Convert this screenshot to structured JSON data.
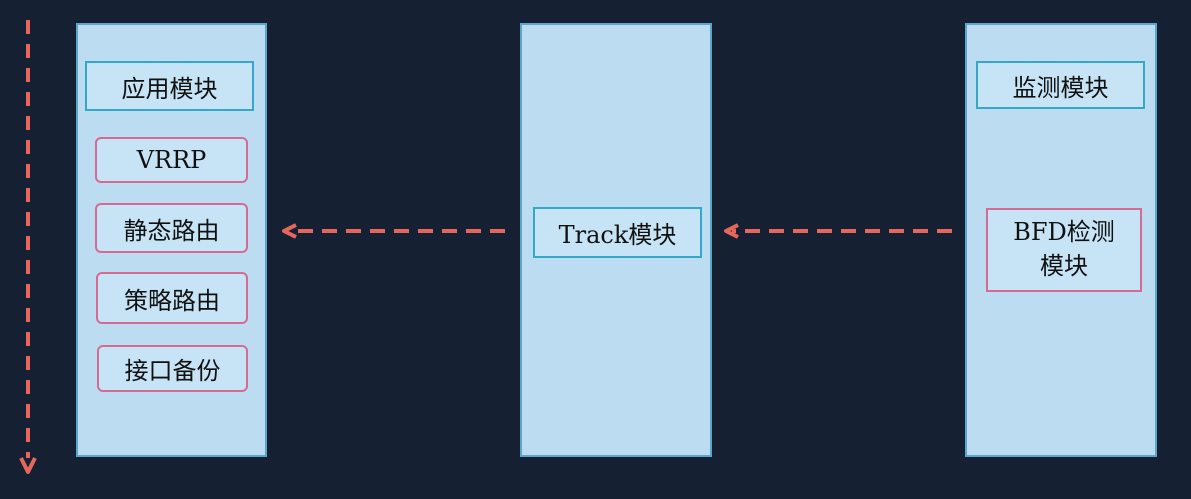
{
  "left_panel": {
    "title": "应用模块",
    "items": [
      "VRRP",
      "静态路由",
      "策略路由",
      "接口备份"
    ]
  },
  "middle_panel": {
    "title": "Track模块"
  },
  "right_panel": {
    "title": "监测模块",
    "sub_line1": "BFD检测",
    "sub_line2": "模块"
  },
  "colors": {
    "background": "#152033",
    "panel_fill": "#bcdcf2",
    "panel_border": "#5ba6c9",
    "title_border": "#35a8c8",
    "item_border": "#d56a92",
    "arrow": "#e8675c"
  }
}
